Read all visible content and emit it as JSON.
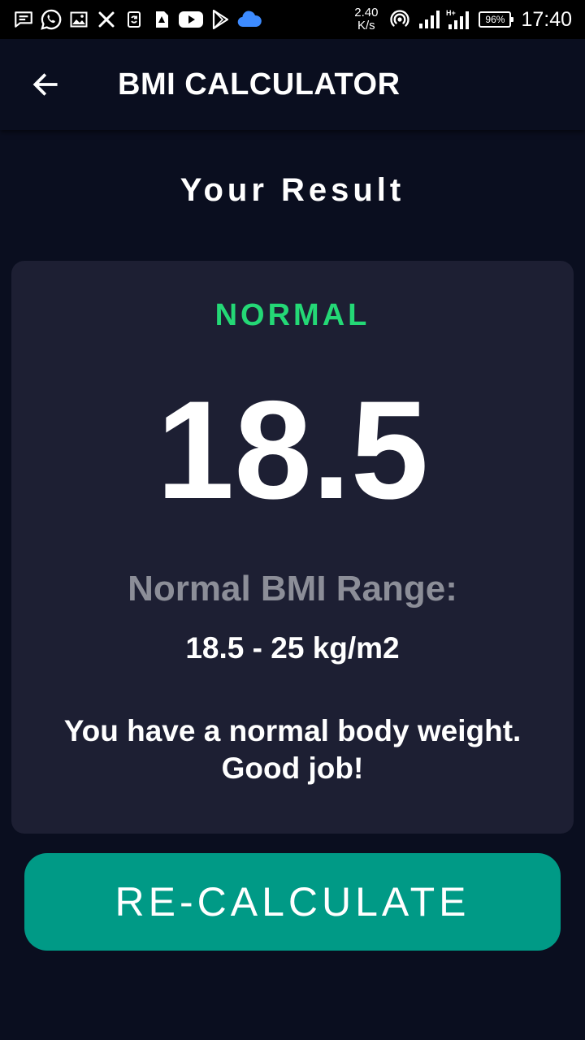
{
  "status_bar": {
    "net_speed_value": "2.40",
    "net_speed_unit": "K/s",
    "battery": "96%",
    "time": "17:40",
    "icons_left": [
      "message-icon",
      "whatsapp-icon",
      "gallery-icon",
      "x-icon",
      "sync-icon",
      "sim-icon",
      "youtube-icon",
      "play-store-icon",
      "cloud-icon"
    ],
    "icons_right": [
      "hotspot-icon",
      "signal-icon",
      "signal-h-plus-icon",
      "battery-icon"
    ]
  },
  "app_bar": {
    "title": "BMI CALCULATOR",
    "back_icon": "arrow-left-icon"
  },
  "result": {
    "heading": "Your Result",
    "status": "NORMAL",
    "bmi": "18.5",
    "range_label": "Normal BMI Range:",
    "range_value": "18.5 - 25 kg/m2",
    "interpretation": "You have a normal body weight. Good job!"
  },
  "actions": {
    "recalculate_label": "RE-CALCULATE"
  },
  "colors": {
    "background": "#0a0e1f",
    "card": "#1d1f33",
    "status_green": "#24d876",
    "range_label_gray": "#8c8e98",
    "button_teal": "#009a86"
  }
}
